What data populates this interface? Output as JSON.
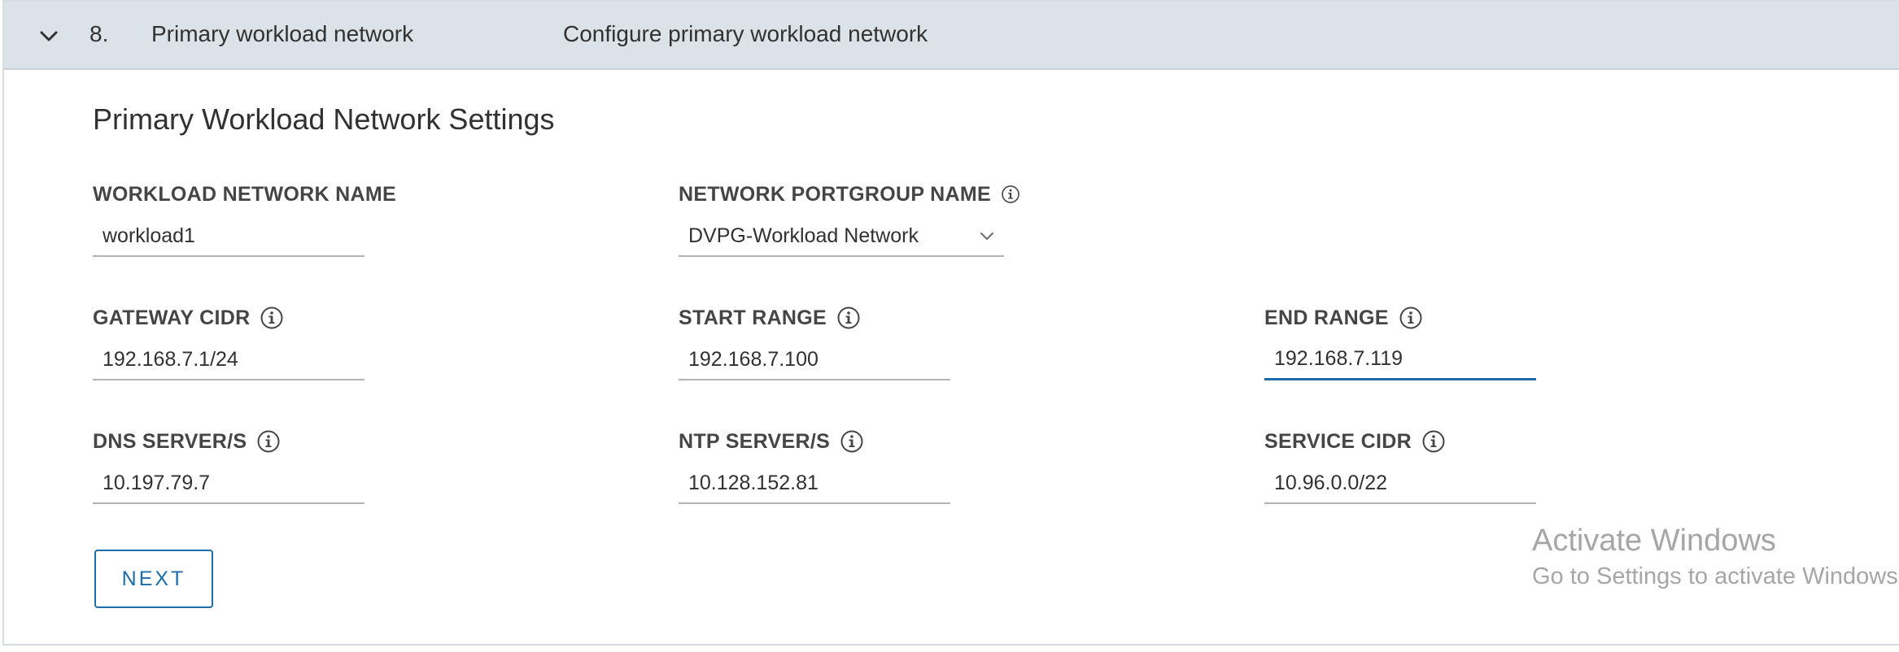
{
  "step": {
    "number": "8.",
    "title": "Primary workload network",
    "description": "Configure primary workload network"
  },
  "section": {
    "title": "Primary Workload Network Settings"
  },
  "fields": {
    "workload_network_name": {
      "label": "WORKLOAD NETWORK NAME",
      "value": "workload1"
    },
    "network_portgroup_name": {
      "label": "NETWORK PORTGROUP NAME",
      "value": "DVPG-Workload Network"
    },
    "gateway_cidr": {
      "label": "GATEWAY CIDR",
      "value": "192.168.7.1/24"
    },
    "start_range": {
      "label": "START RANGE",
      "value": "192.168.7.100"
    },
    "end_range": {
      "label": "END RANGE",
      "value": "192.168.7.119"
    },
    "dns_servers": {
      "label": "DNS SERVER/S",
      "value": "10.197.79.7"
    },
    "ntp_servers": {
      "label": "NTP SERVER/S",
      "value": "10.128.152.81"
    },
    "service_cidr": {
      "label": "SERVICE CIDR",
      "value": "10.96.0.0/22"
    }
  },
  "buttons": {
    "next_label": "NEXT"
  },
  "watermark": {
    "title": "Activate Windows",
    "subtitle": "Go to Settings to activate Windows."
  },
  "icons": {
    "collapse": "chevron-down-icon",
    "info": "info-icon",
    "dropdown": "chevron-down-icon"
  },
  "colors": {
    "header_bg": "#dbe3e9",
    "accent": "#1b6ca8",
    "text": "#313131",
    "watermark": "#a6a6a6"
  }
}
